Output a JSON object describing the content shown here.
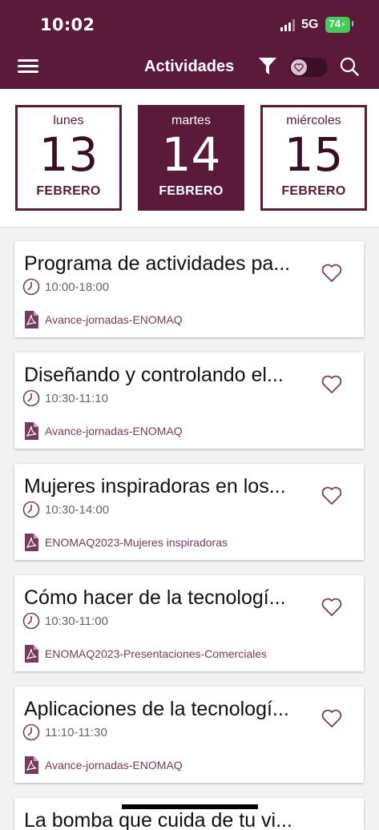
{
  "status_bar": {
    "time": "10:02",
    "network": "5G",
    "battery": "74"
  },
  "app_bar": {
    "title": "Actividades"
  },
  "dates": [
    {
      "weekday": "lunes",
      "day": "13",
      "month": "FEBRERO",
      "selected": false
    },
    {
      "weekday": "martes",
      "day": "14",
      "month": "FEBRERO",
      "selected": true
    },
    {
      "weekday": "miércoles",
      "day": "15",
      "month": "FEBRERO",
      "selected": false
    }
  ],
  "activities": [
    {
      "title": "Programa de actividades pa...",
      "time": "10:00-18:00",
      "file": "Avance-jornadas-ENOMAQ"
    },
    {
      "title": "Diseñando y controlando el...",
      "time": "10:30-11:10",
      "file": "Avance-jornadas-ENOMAQ"
    },
    {
      "title": "Mujeres inspiradoras en los...",
      "time": "10:30-14:00",
      "file": "ENOMAQ2023-Mujeres inspiradoras"
    },
    {
      "title": "Cómo hacer de la tecnologí...",
      "time": "10:30-11:00",
      "file": "ENOMAQ2023-Presentaciones-Comerciales"
    },
    {
      "title": "Aplicaciones de la tecnologí...",
      "time": "11:10-11:30",
      "file": "Avance-jornadas-ENOMAQ"
    },
    {
      "title": "La bomba que cuida de tu vi...",
      "time": "",
      "file": ""
    }
  ],
  "colors": {
    "primary": "#5c1a3b",
    "accent_text": "#7a3a5c",
    "battery": "#44c95a"
  },
  "icons": {
    "menu": "hamburger-icon",
    "filter": "filter-icon",
    "favorites": "heart-icon",
    "search": "search-icon",
    "time": "clock-icon",
    "file": "pdf-icon"
  }
}
